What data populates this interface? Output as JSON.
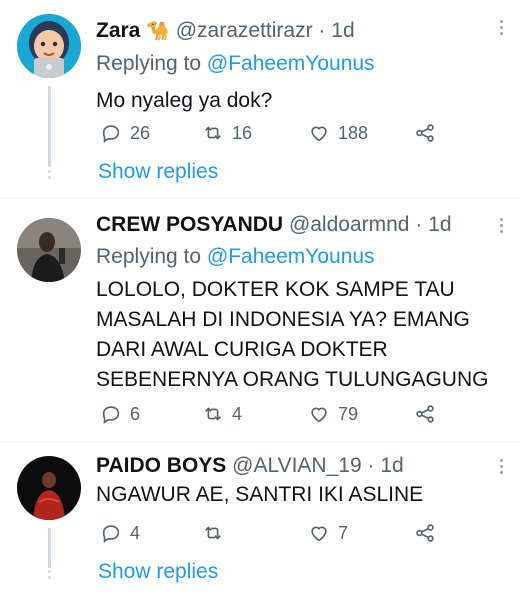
{
  "tweets": [
    {
      "name": "Zara",
      "name_emoji": "🐪",
      "handle": "@zarazettirazr",
      "separator": "·",
      "time": "1d",
      "replying_prefix": "Replying to",
      "replying_to": "@FaheemYounus",
      "text": "Mo nyaleg ya dok?",
      "replies": "26",
      "retweets": "16",
      "likes": "188",
      "show_replies": "Show replies"
    },
    {
      "name": "CREW POSYANDU",
      "handle": "@aldoarmnd",
      "separator": "·",
      "time": "1d",
      "replying_prefix": "Replying to",
      "replying_to": "@FaheemYounus",
      "text_lines": [
        "LOLOLO, DOKTER KOK SAMPE TAU",
        "MASALAH DI INDONESIA YA? EMANG",
        "DARI AWAL CURIGA DOKTER",
        "SEBENERNYA ORANG TULUNGAGUNG"
      ],
      "replies": "6",
      "retweets": "4",
      "likes": "79"
    },
    {
      "name": "PAIDO BOYS",
      "handle": "@ALVIAN_19",
      "separator": "·",
      "time": "1d",
      "text": "NGAWUR AE, SANTRI IKI ASLINE",
      "replies": "4",
      "retweets": "",
      "likes": "7",
      "show_replies": "Show replies"
    }
  ],
  "colors": {
    "link": "#1d9bf0",
    "muted": "#536471",
    "text": "#0f1419",
    "thread_line": "#cfd9de"
  },
  "icons": [
    "memoji-avatar",
    "reply-icon",
    "retweet-icon",
    "like-icon",
    "share-icon",
    "more-icon"
  ]
}
